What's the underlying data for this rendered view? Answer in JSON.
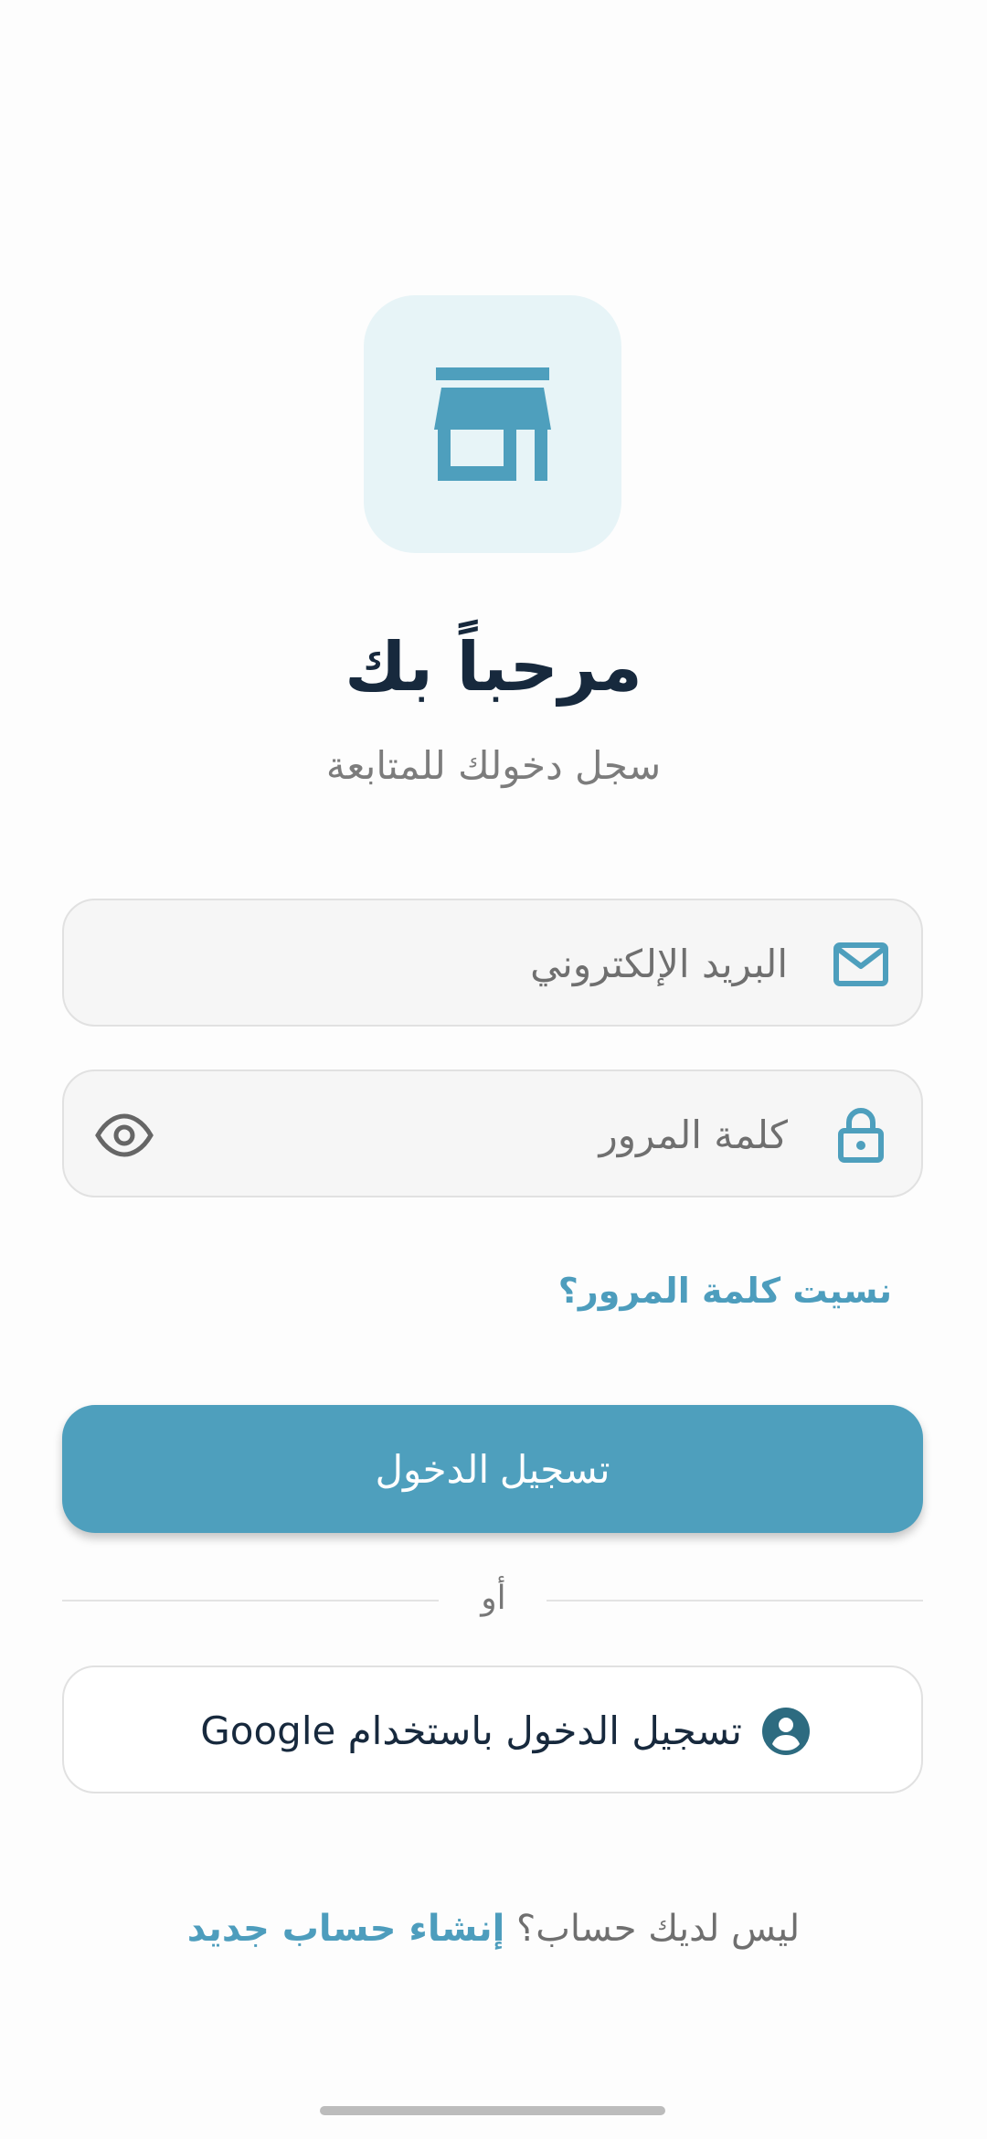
{
  "app": {
    "title": "مرحباً بك",
    "subtitle": "سجل دخولك للمتابعة",
    "logo_icon": "store-icon",
    "accent_color": "#4e9fbd",
    "title_color": "#17293d"
  },
  "form": {
    "email": {
      "placeholder": "البريد الإلكتروني",
      "icon": "mail-icon"
    },
    "password": {
      "placeholder": "كلمة المرور",
      "icon": "lock-icon",
      "toggle_icon": "eye-icon"
    },
    "forgot_password": "نسيت كلمة المرور؟",
    "login_button": "تسجيل الدخول"
  },
  "divider": {
    "label": "أو"
  },
  "google": {
    "label": "تسجيل الدخول باستخدام Google",
    "icon": "account-circle-icon"
  },
  "signup": {
    "question": "ليس لديك حساب؟",
    "link": "إنشاء حساب جديد"
  }
}
